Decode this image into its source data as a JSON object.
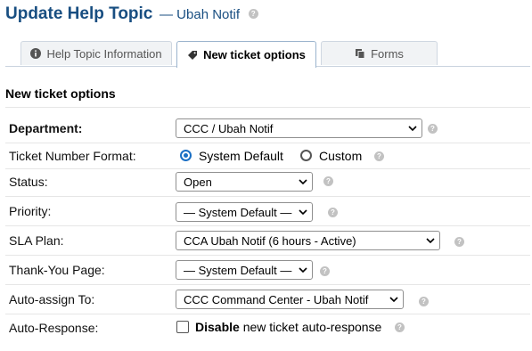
{
  "header": {
    "title": "Update Help Topic",
    "subtitle": "— Ubah Notif"
  },
  "tabs": [
    {
      "label": "Help Topic Information",
      "icon": "info-icon"
    },
    {
      "label": "New ticket options",
      "icon": "tag-icon",
      "active": true
    },
    {
      "label": "Forms",
      "icon": "copy-icon"
    }
  ],
  "section": {
    "title": "New ticket options"
  },
  "form": {
    "department": {
      "label": "Department:",
      "value": "CCC / Ubah Notif"
    },
    "ticket_number_format": {
      "label": "Ticket Number Format:",
      "option1": "System Default",
      "option2": "Custom",
      "selected": "System Default"
    },
    "status": {
      "label": "Status:",
      "value": "Open"
    },
    "priority": {
      "label": "Priority:",
      "value": "— System Default —"
    },
    "sla_plan": {
      "label": "SLA Plan:",
      "value": "CCA Ubah Notif (6 hours - Active)"
    },
    "thank_you_page": {
      "label": "Thank-You Page:",
      "value": "— System Default —"
    },
    "auto_assign": {
      "label": "Auto-assign To:",
      "value": "CCC Command Center - Ubah Notif"
    },
    "auto_response": {
      "label": "Auto-Response:",
      "checkbox_bold": "Disable",
      "checkbox_text": "new ticket auto-response",
      "checked": false
    }
  },
  "colors": {
    "title": "#184e81",
    "radio": "#1a6fc4",
    "help_icon": "#c2c2c2"
  }
}
